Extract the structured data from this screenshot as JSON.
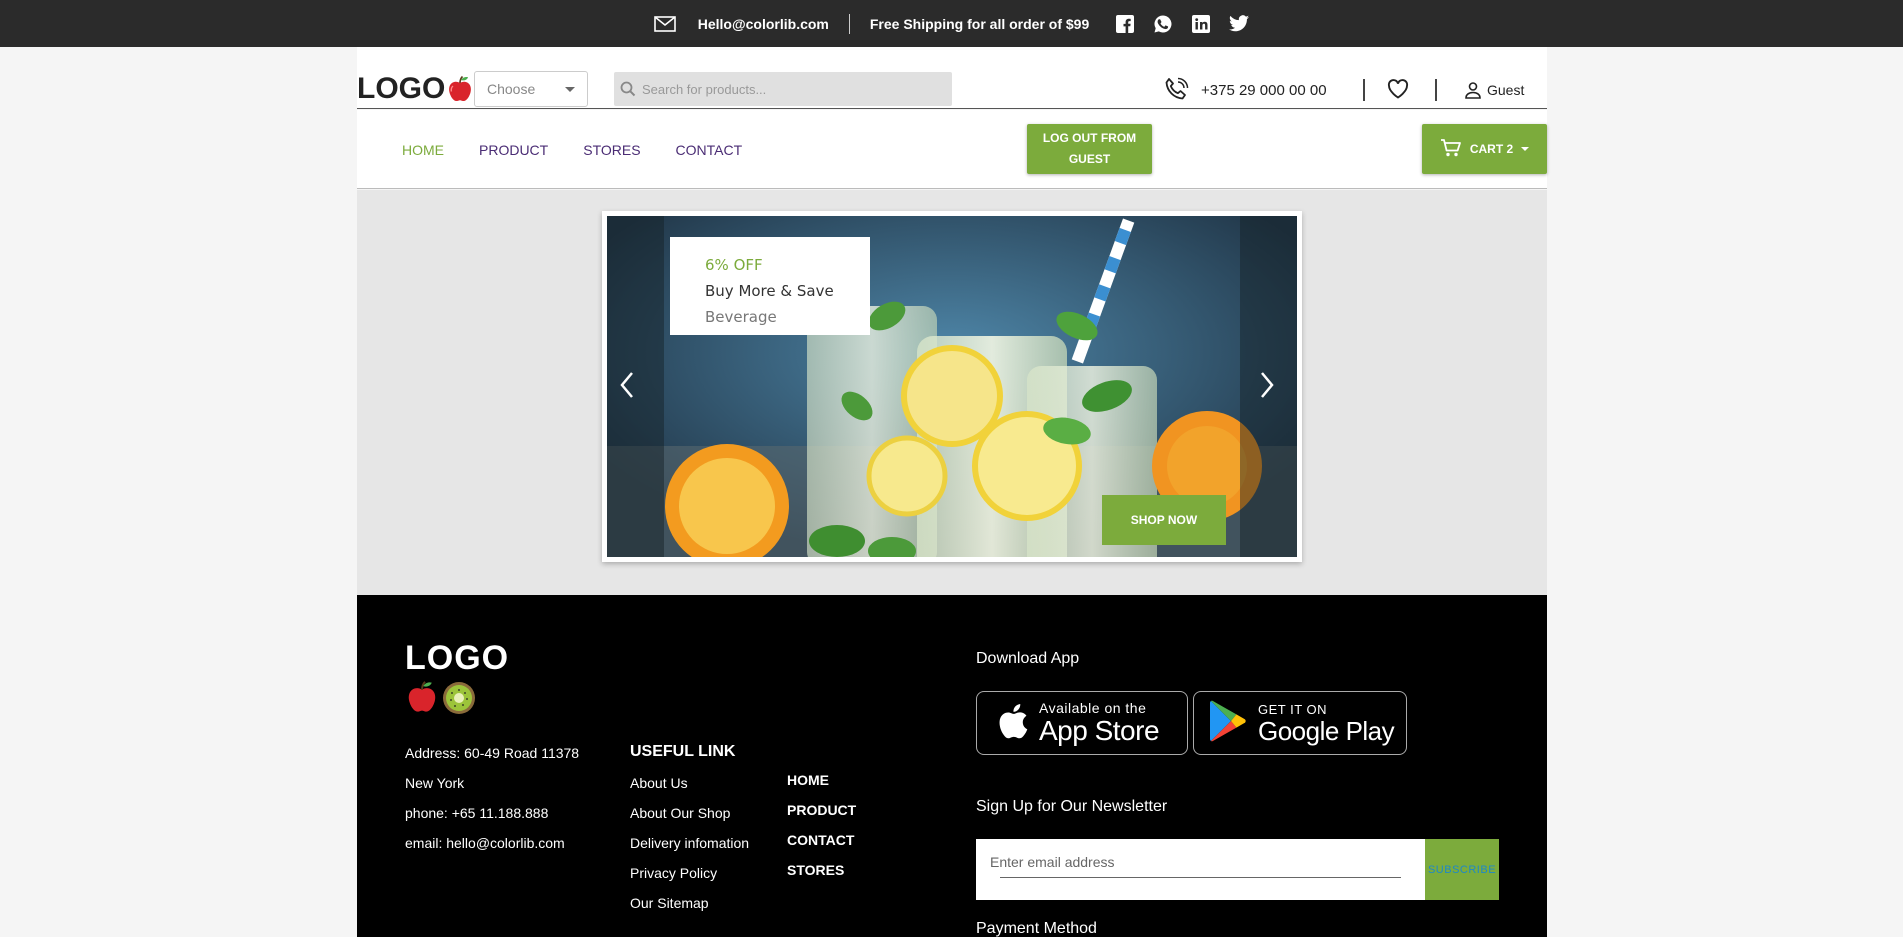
{
  "topbar": {
    "email": "Hello@colorlib.com",
    "shipping": "Free Shipping for all order of $99",
    "socials": [
      "facebook-icon",
      "whatsapp-icon",
      "linkedin-icon",
      "twitter-icon"
    ]
  },
  "header": {
    "logo": "LOGO",
    "choose_placeholder": "Choose",
    "search_placeholder": "Search for products...",
    "phone": "+375 29 000 00 00",
    "user": "Guest"
  },
  "nav": {
    "items": [
      "HOME",
      "PRODUCT",
      "STORES",
      "CONTACT"
    ],
    "active": "HOME",
    "logout": "LOG OUT FROM GUEST",
    "cart": "CART 2"
  },
  "hero": {
    "promo_off": "6% OFF",
    "promo_title": "Buy More & Save",
    "promo_sub": "Beverage",
    "cta": "SHOP NOW"
  },
  "footer": {
    "logo": "LOGO",
    "address_line1": "Address: 60-49 Road 11378",
    "address_line2": "New York",
    "phone": "phone: +65 11.188.888",
    "email": "email: hello@colorlib.com",
    "useful_title": "USEFUL LINK",
    "useful_links": [
      "About Us",
      "About Our Shop",
      "Delivery infomation",
      "Privacy Policy",
      "Our Sitemap"
    ],
    "nav_links": [
      "HOME",
      "PRODUCT",
      "CONTACT",
      "STORES"
    ],
    "download_title": "Download App",
    "appstore_small": "Available on the",
    "appstore_big": "App Store",
    "googleplay_small": "GET IT ON",
    "googleplay_big": "Google Play",
    "newsletter_title": "Sign Up for Our Newsletter",
    "email_placeholder": "Enter email address",
    "subscribe": "SUBSCRIBE",
    "payment_title": "Payment Method"
  },
  "colors": {
    "accent": "#7cab3c",
    "nav_text": "#4a2c74",
    "topbar": "#2b2b2b",
    "footer": "#000000"
  }
}
